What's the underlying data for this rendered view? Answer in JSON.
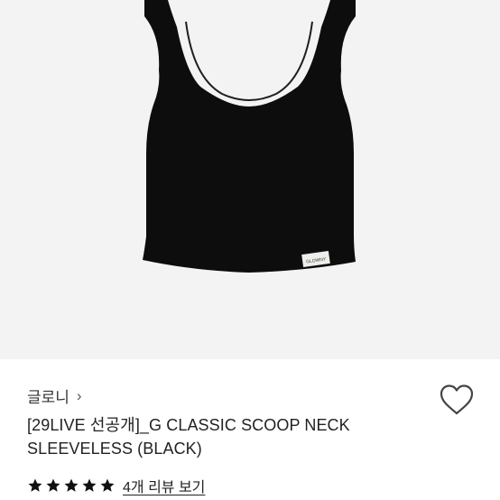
{
  "product": {
    "brand": "글로니",
    "brand_chevron": "›",
    "title_line1": "[29LIVE 선공개]_G CLASSIC SCOOP NECK",
    "title_line2": "SLEEVELESS (BLACK)",
    "label_text": "GLOWNY",
    "rating_value": 5,
    "rating_max": 5,
    "review_link": "4개 리뷰 보기"
  },
  "colors": {
    "image_background": "#f3f3f3",
    "garment": "#0d0d0d",
    "star": "#111111",
    "heart_outline": "#444444"
  },
  "icons": {
    "wishlist": "heart-outline-icon",
    "star": "star-icon",
    "chevron": "chevron-right-icon"
  }
}
